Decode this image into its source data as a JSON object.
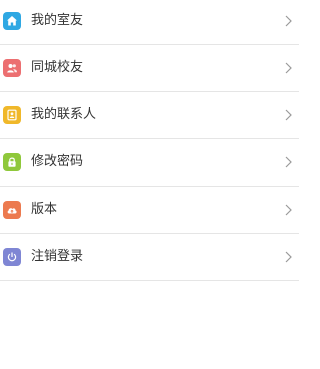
{
  "menu": {
    "items": [
      {
        "label": "我的室友",
        "icon": "home-icon",
        "color": "#2fa8e3"
      },
      {
        "label": "同城校友",
        "icon": "people-icon",
        "color": "#ec6f71"
      },
      {
        "label": "我的联系人",
        "icon": "contact-icon",
        "color": "#f0b82a"
      },
      {
        "label": "修改密码",
        "icon": "lock-icon",
        "color": "#8fc83b"
      },
      {
        "label": "版本",
        "icon": "cloud-upload-icon",
        "color": "#ec7a4f"
      },
      {
        "label": "注销登录",
        "icon": "power-icon",
        "color": "#7f86d4"
      }
    ],
    "chevron_icon": "chevron-right-icon",
    "divider_color": "#e5e5e5",
    "text_color": "#333333"
  }
}
